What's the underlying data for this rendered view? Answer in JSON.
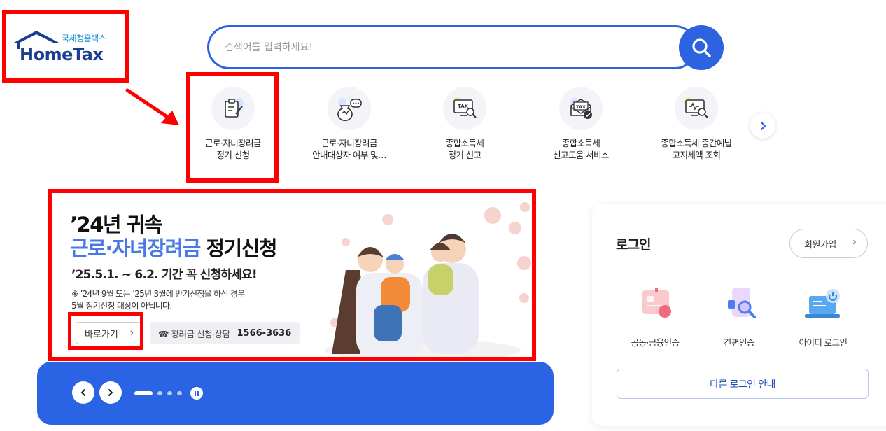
{
  "logo": {
    "korean": "국세청홈택스",
    "english": "HomeTax"
  },
  "search": {
    "placeholder": "검색어를 입력하세요!"
  },
  "quick_menu": [
    {
      "label": "근로·자녀장려금\n정기 신청",
      "icon": "clipboard-edit-icon"
    },
    {
      "label": "근로·자녀장려금\n안내대상자 여부 및…",
      "icon": "money-chat-icon"
    },
    {
      "label": "종합소득세\n정기 신고",
      "icon": "tax-monitor-search-icon"
    },
    {
      "label": "종합소득세\n신고도움 서비스",
      "icon": "tax-envelope-check-icon"
    },
    {
      "label": "종합소득세 중간예납\n고지세액 조회",
      "icon": "monitor-search-icon"
    }
  ],
  "banner": {
    "line1": "’24년 귀속",
    "line2_highlight": "근로·자녀장려금",
    "line2_rest": " 정기신청",
    "line3": "’25.5.1. ~ 6.2. 기간 꼭 신청하세요!",
    "note": "※ ’24년 9월 또는 ’25년 3월에 반기신청을 하신 경우\n     5월 정기신청 대상이 아닙니다.",
    "go_button": "바로가기",
    "tel_label": "☎ 장려금 신청·상담",
    "tel_number": "1566-3636"
  },
  "carousel": {
    "total_slides": 4,
    "active_slide": 1
  },
  "login": {
    "title": "로그인",
    "join": "회원가입",
    "options": [
      {
        "label": "공동·금융인증",
        "icon": "certificate-card-icon"
      },
      {
        "label": "간편인증",
        "icon": "mobile-auth-icon"
      },
      {
        "label": "아이디 로그인",
        "icon": "id-login-laptop-icon"
      }
    ],
    "other": "다른 로그인 안내"
  },
  "colors": {
    "brand_blue": "#2b63e5",
    "highlight_red": "#ff0000",
    "logo_navy": "#1a3f8f"
  }
}
